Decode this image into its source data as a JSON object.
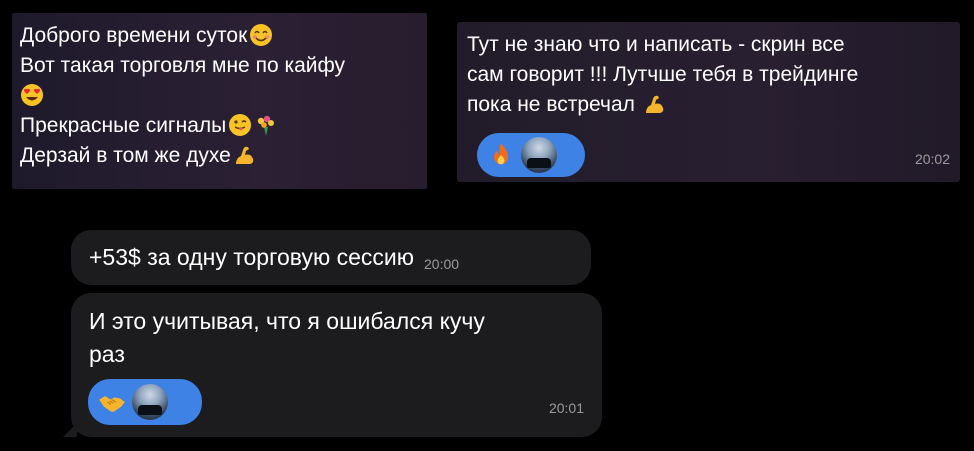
{
  "messages": [
    {
      "lines": [
        "Доброго времени суток",
        "Вот такая торговля мне по кайфу",
        "",
        "Прекрасные сигналы",
        "Дерзай в том же духе"
      ]
    },
    {
      "lines": [
        "Тут не знаю что и написать - скрин все",
        "сам говорит !!! Лутчше тебя в трейдинге",
        "пока не встречал"
      ],
      "time": "20:02",
      "reactions": [
        "fire-icon",
        "avatar"
      ]
    },
    {
      "text": "+53$ за одну торговую сессию",
      "time": "20:00"
    },
    {
      "lines": [
        "И это учитывая, что я ошибался кучу",
        "раз"
      ],
      "time": "20:01",
      "reactions": [
        "handshake-icon",
        "avatar"
      ]
    }
  ],
  "colors": {
    "reaction_pill": "#3f82e6",
    "bubble_dark": "#1c1c1e",
    "bubble_purple": "#2b2034",
    "timestamp": "#8e8e93"
  }
}
